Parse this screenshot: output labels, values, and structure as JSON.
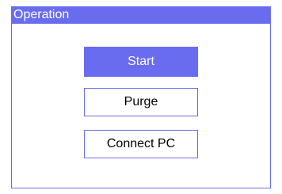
{
  "window": {
    "title": "Operation"
  },
  "buttons": {
    "start_label": "Start",
    "purge_label": "Purge",
    "connect_label": "Connect PC"
  },
  "colors": {
    "accent": "#6a6cf0",
    "background": "#ffffff"
  }
}
